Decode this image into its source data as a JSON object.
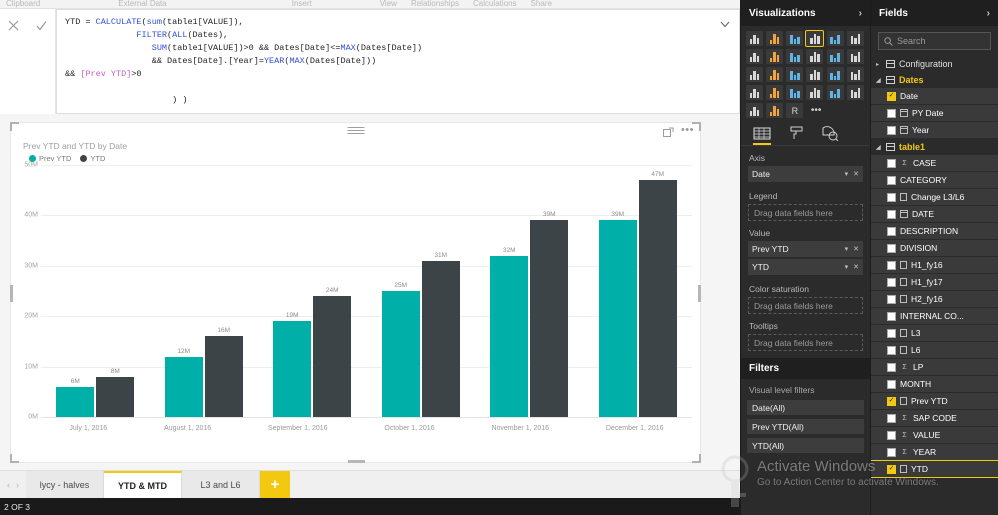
{
  "ribbon": {
    "tabs": [
      "Clipboard",
      "External Data",
      "Insert",
      "View",
      "Relationships",
      "Calculations",
      "Share"
    ]
  },
  "formula": {
    "cancel_icon": "close-icon",
    "accept_icon": "check-icon",
    "expand_icon": "chevron-down-icon",
    "lines": [
      "YTD = CALCULATE(sum(table1[VALUE]),",
      "              FILTER(ALL(Dates),",
      "                 SUM(table1[VALUE])>0 && Dates[Date]<=MAX(Dates[Date])",
      "                 && Dates[Date].[Year]=YEAR(MAX(Dates[Date]))",
      "&& [Prev YTD]>0",
      "",
      "                     ) )"
    ]
  },
  "visual": {
    "title": "Prev YTD and YTD by Date",
    "focus_icon": "focus-mode-icon",
    "more_icon": "more-options-icon",
    "grip_icon": "drag-handle-icon"
  },
  "chart_data": {
    "type": "bar",
    "title": "Prev YTD and YTD by Date",
    "xlabel": "",
    "ylabel": "",
    "categories": [
      "July 1, 2016",
      "August 1, 2016",
      "September 1, 2016",
      "October 1, 2016",
      "November 1, 2016",
      "December 1, 2016"
    ],
    "series": [
      {
        "name": "Prev YTD",
        "color": "#00b0a8",
        "values": [
          6,
          12,
          19,
          25,
          32,
          39
        ],
        "labels": [
          "6M",
          "12M",
          "19M",
          "25M",
          "32M",
          "39M"
        ]
      },
      {
        "name": "YTD",
        "color": "#3c4448",
        "values": [
          8,
          16,
          24,
          31,
          39,
          47
        ],
        "labels": [
          "8M",
          "16M",
          "24M",
          "31M",
          "39M",
          "47M"
        ]
      }
    ],
    "yticks": [
      "0M",
      "10M",
      "20M",
      "30M",
      "40M",
      "50M"
    ],
    "ylim": [
      0,
      50
    ],
    "unit": "M",
    "grid": true,
    "legend_position": "top-left"
  },
  "tabbar": {
    "prev_icon": "chevron-left-icon",
    "next_icon": "chevron-right-icon",
    "tabs": [
      {
        "label": "lycy - halves",
        "active": false
      },
      {
        "label": "YTD & MTD",
        "active": true
      },
      {
        "label": "L3 and L6",
        "active": false
      }
    ],
    "add_label": "+"
  },
  "statusbar": {
    "text": "2 OF 3"
  },
  "visualizations": {
    "title": "Visualizations",
    "expand_icon": "chevron-right-icon",
    "icon_names": [
      "stacked-bar-chart-icon",
      "stacked-column-chart-icon",
      "clustered-bar-chart-icon",
      "clustered-column-chart-icon",
      "100-stacked-bar-chart-icon",
      "100-stacked-column-chart-icon",
      "line-chart-icon",
      "area-chart-icon",
      "stacked-area-chart-icon",
      "line-stacked-column-chart-icon",
      "line-clustered-column-chart-icon",
      "ribbon-chart-icon",
      "scatter-chart-icon",
      "pie-chart-icon",
      "treemap-icon",
      "map-icon",
      "matrix-icon",
      "table-icon",
      "filled-map-icon",
      "funnel-icon",
      "gauge-icon",
      "card-icon",
      "multi-row-card-icon",
      "kpi-icon",
      "slicer-icon",
      "donut-chart-icon",
      "r-script-visual-icon",
      "more-visuals-icon"
    ],
    "selected_icon_index": 3,
    "panel_tabs": [
      {
        "name": "fields-tab",
        "active": true
      },
      {
        "name": "format-tab",
        "active": false
      },
      {
        "name": "analytics-tab",
        "active": false
      }
    ],
    "wells": [
      {
        "label": "Axis",
        "chips": [
          "Date"
        ],
        "placeholder": null
      },
      {
        "label": "Legend",
        "chips": [],
        "placeholder": "Drag data fields here"
      },
      {
        "label": "Value",
        "chips": [
          "Prev YTD",
          "YTD"
        ],
        "placeholder": null
      },
      {
        "label": "Color saturation",
        "chips": [],
        "placeholder": "Drag data fields here"
      },
      {
        "label": "Tooltips",
        "chips": [],
        "placeholder": "Drag data fields here"
      }
    ],
    "chip_dropdown_icon": "chevron-down-icon",
    "chip_remove_icon": "close-icon"
  },
  "filters": {
    "title": "Filters",
    "subtitle": "Visual level filters",
    "items": [
      "Date(All)",
      "Prev YTD(All)",
      "YTD(All)"
    ]
  },
  "fields": {
    "title": "Fields",
    "expand_icon": "chevron-right-icon",
    "search_placeholder": "Search",
    "search_icon": "search-icon",
    "search_value": "",
    "groups": [
      {
        "name": "Configuration",
        "expanded": false,
        "icon": "table-icon",
        "fields": []
      },
      {
        "name": "Dates",
        "expanded": true,
        "icon": "table-icon",
        "fields": [
          {
            "name": "Date",
            "checked": true,
            "type_icon": "none"
          },
          {
            "name": "PY Date",
            "checked": false,
            "type_icon": "calendar-icon"
          },
          {
            "name": "Year",
            "checked": false,
            "type_icon": "calendar-icon"
          }
        ]
      },
      {
        "name": "table1",
        "expanded": true,
        "icon": "table-icon",
        "fields": [
          {
            "name": "CASE",
            "checked": false,
            "type_icon": "sigma-icon"
          },
          {
            "name": "CATEGORY",
            "checked": false,
            "type_icon": "none"
          },
          {
            "name": "Change L3/L6",
            "checked": false,
            "type_icon": "measure-icon"
          },
          {
            "name": "DATE",
            "checked": false,
            "type_icon": "calendar-icon"
          },
          {
            "name": "DESCRIPTION",
            "checked": false,
            "type_icon": "none"
          },
          {
            "name": "DIVISION",
            "checked": false,
            "type_icon": "none"
          },
          {
            "name": "H1_fy16",
            "checked": false,
            "type_icon": "measure-icon"
          },
          {
            "name": "H1_fy17",
            "checked": false,
            "type_icon": "measure-icon"
          },
          {
            "name": "H2_fy16",
            "checked": false,
            "type_icon": "measure-icon"
          },
          {
            "name": "INTERNAL CO...",
            "checked": false,
            "type_icon": "none"
          },
          {
            "name": "L3",
            "checked": false,
            "type_icon": "measure-icon"
          },
          {
            "name": "L6",
            "checked": false,
            "type_icon": "measure-icon"
          },
          {
            "name": "LP",
            "checked": false,
            "type_icon": "sigma-icon"
          },
          {
            "name": "MONTH",
            "checked": false,
            "type_icon": "none"
          },
          {
            "name": "Prev YTD",
            "checked": true,
            "type_icon": "measure-icon"
          },
          {
            "name": "SAP CODE",
            "checked": false,
            "type_icon": "sigma-icon"
          },
          {
            "name": "VALUE",
            "checked": false,
            "type_icon": "sigma-icon"
          },
          {
            "name": "YEAR",
            "checked": false,
            "type_icon": "sigma-icon"
          },
          {
            "name": "YTD",
            "checked": true,
            "type_icon": "measure-icon",
            "selected": true
          }
        ]
      }
    ]
  },
  "watermark": {
    "line1": "Activate Windows",
    "line2": "Go to Action Center to activate Windows."
  },
  "colors": {
    "prev_ytd": "#00b0a8",
    "ytd": "#3c4448",
    "accent": "#f2c811",
    "pane_bg": "#2b2b2b"
  }
}
